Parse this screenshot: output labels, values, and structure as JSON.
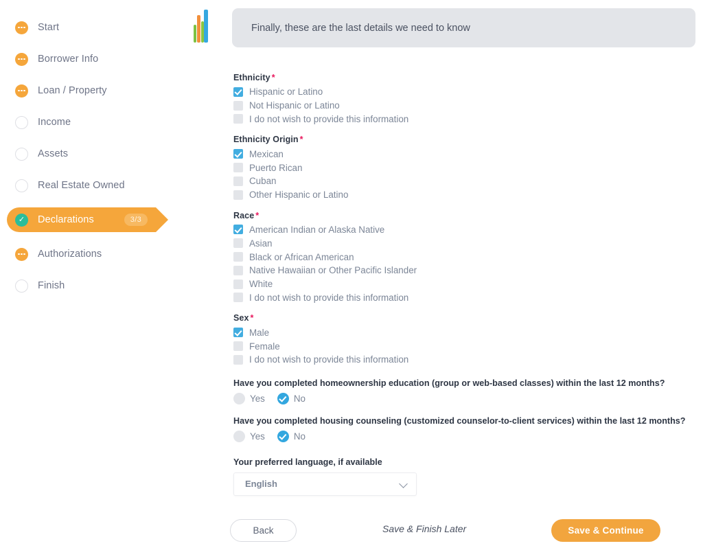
{
  "brand": {
    "accent_orange": "#F5A63B",
    "accent_blue": "#42ADE0",
    "accent_green": "#2BBD9A",
    "required_pink": "#E8185D",
    "logo_name": "app-logo"
  },
  "sidebar": {
    "items": [
      {
        "label": "Start",
        "state": "done"
      },
      {
        "label": "Borrower Info",
        "state": "done"
      },
      {
        "label": "Loan / Property",
        "state": "done"
      },
      {
        "label": "Income",
        "state": "empty"
      },
      {
        "label": "Assets",
        "state": "empty"
      },
      {
        "label": "Real Estate Owned",
        "state": "empty"
      },
      {
        "label": "Declarations",
        "state": "active",
        "badge": "3/3",
        "check": "✓"
      },
      {
        "label": "Authorizations",
        "state": "done"
      },
      {
        "label": "Finish",
        "state": "empty"
      }
    ]
  },
  "banner": {
    "text": "Finally, these are the last details we need to know"
  },
  "form": {
    "required_mark": "*",
    "groups": [
      {
        "title": "Ethnicity",
        "required": true,
        "options": [
          {
            "label": "Hispanic or Latino",
            "checked": true
          },
          {
            "label": "Not Hispanic or Latino",
            "checked": false
          },
          {
            "label": "I do not wish to provide this information",
            "checked": false
          }
        ]
      },
      {
        "title": "Ethnicity Origin",
        "required": true,
        "options": [
          {
            "label": "Mexican",
            "checked": true
          },
          {
            "label": "Puerto Rican",
            "checked": false
          },
          {
            "label": "Cuban",
            "checked": false
          },
          {
            "label": "Other Hispanic or Latino",
            "checked": false
          }
        ]
      },
      {
        "title": "Race",
        "required": true,
        "options": [
          {
            "label": "American Indian or Alaska Native",
            "checked": true
          },
          {
            "label": "Asian",
            "checked": false
          },
          {
            "label": "Black or African American",
            "checked": false
          },
          {
            "label": "Native Hawaiian or Other Pacific Islander",
            "checked": false
          },
          {
            "label": "White",
            "checked": false
          },
          {
            "label": "I do not wish to provide this information",
            "checked": false
          }
        ]
      },
      {
        "title": "Sex",
        "required": true,
        "options": [
          {
            "label": "Male",
            "checked": true
          },
          {
            "label": "Female",
            "checked": false
          },
          {
            "label": "I do not wish to provide this information",
            "checked": false
          }
        ]
      }
    ],
    "questions": [
      {
        "text": "Have you completed homeownership education (group or web-based classes) within the last 12 months?",
        "options": [
          {
            "label": "Yes",
            "selected": false
          },
          {
            "label": "No",
            "selected": true
          }
        ]
      },
      {
        "text": "Have you completed housing counseling (customized counselor-to-client services) within the last 12 months?",
        "options": [
          {
            "label": "Yes",
            "selected": false
          },
          {
            "label": "No",
            "selected": true
          }
        ]
      }
    ],
    "language_select": {
      "label": "Your preferred language, if available",
      "value": "English"
    }
  },
  "footer": {
    "back_label": "Back",
    "save_later_label": "Save & Finish Later",
    "continue_label": "Save & Continue"
  }
}
